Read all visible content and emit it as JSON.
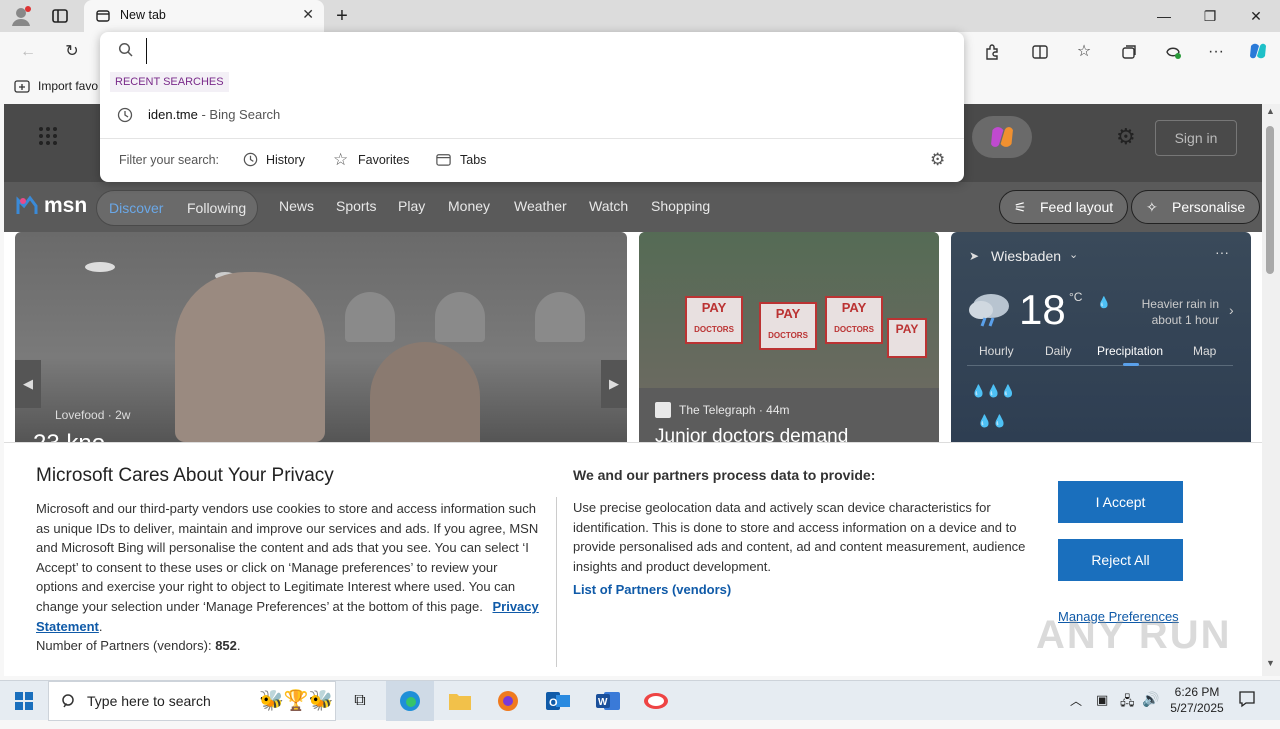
{
  "browser": {
    "tab_title": "New tab",
    "fav_bar_item": "Import favo",
    "omnibox_value": ""
  },
  "omnibox_dropdown": {
    "section_header": "RECENT SEARCHES",
    "recent_query": "iden.tme",
    "recent_source": " - Bing Search",
    "filter_label": "Filter your search:",
    "filters": [
      "History",
      "Favorites",
      "Tabs"
    ]
  },
  "msn": {
    "logo_text": "msn",
    "sign_in": "Sign in",
    "nav_pill": [
      "Discover",
      "Following"
    ],
    "nav_links": [
      "News",
      "Sports",
      "Play",
      "Money",
      "Weather",
      "Watch",
      "Shopping"
    ],
    "feed_layout": "Feed layout",
    "personalise": "Personalise"
  },
  "card_main": {
    "source": "Lovefood",
    "age": "2w",
    "headline_partial": "23 kno..."
  },
  "card_news": {
    "source": "The Telegraph",
    "age": "44m",
    "headline": "Junior doctors demand",
    "sign_texts": [
      "PAY",
      "DOCTORS"
    ]
  },
  "weather": {
    "location": "Wiesbaden",
    "temperature": "18",
    "unit": "°C",
    "summary": "Heavier rain in about 1 hour",
    "tabs": [
      "Hourly",
      "Daily",
      "Precipitation",
      "Map"
    ],
    "active_tab": "Precipitation"
  },
  "privacy": {
    "title": "Microsoft Cares About Your Privacy",
    "body": "Microsoft and our third-party vendors use cookies to store and access information such as unique IDs to deliver, maintain and improve our services and ads. If you agree, MSN and Microsoft Bing will personalise the content and ads that you see. You can select ‘I Accept’ to consent to these uses or click on ‘Manage preferences’ to review your options and exercise your right to object to Legitimate Interest where used.  You can change your selection under ‘Manage Preferences’ at the bottom of this page.",
    "privacy_link": "Privacy Statement",
    "partners_label": "Number of Partners (vendors): ",
    "partners_count": "852",
    "process_title": "We and our partners process data to provide:",
    "process_body": "Use precise geolocation data and actively scan device characteristics for identification. This is done to store and access information on a device and to provide personalised ads and content, ad and content measurement, audience insights and product development.",
    "partners_link": "List of Partners (vendors)",
    "accept": "I Accept",
    "reject": "Reject All",
    "manage": "Manage Preferences"
  },
  "taskbar": {
    "search_placeholder": "Type here to search",
    "time": "6:26 PM",
    "date": "5/27/2025"
  },
  "watermark": "ANY RUN",
  "colors": {
    "accent_blue": "#1a6fbd",
    "link_blue": "#0f5aa8",
    "recent_label_purple": "#7a2a8a"
  }
}
